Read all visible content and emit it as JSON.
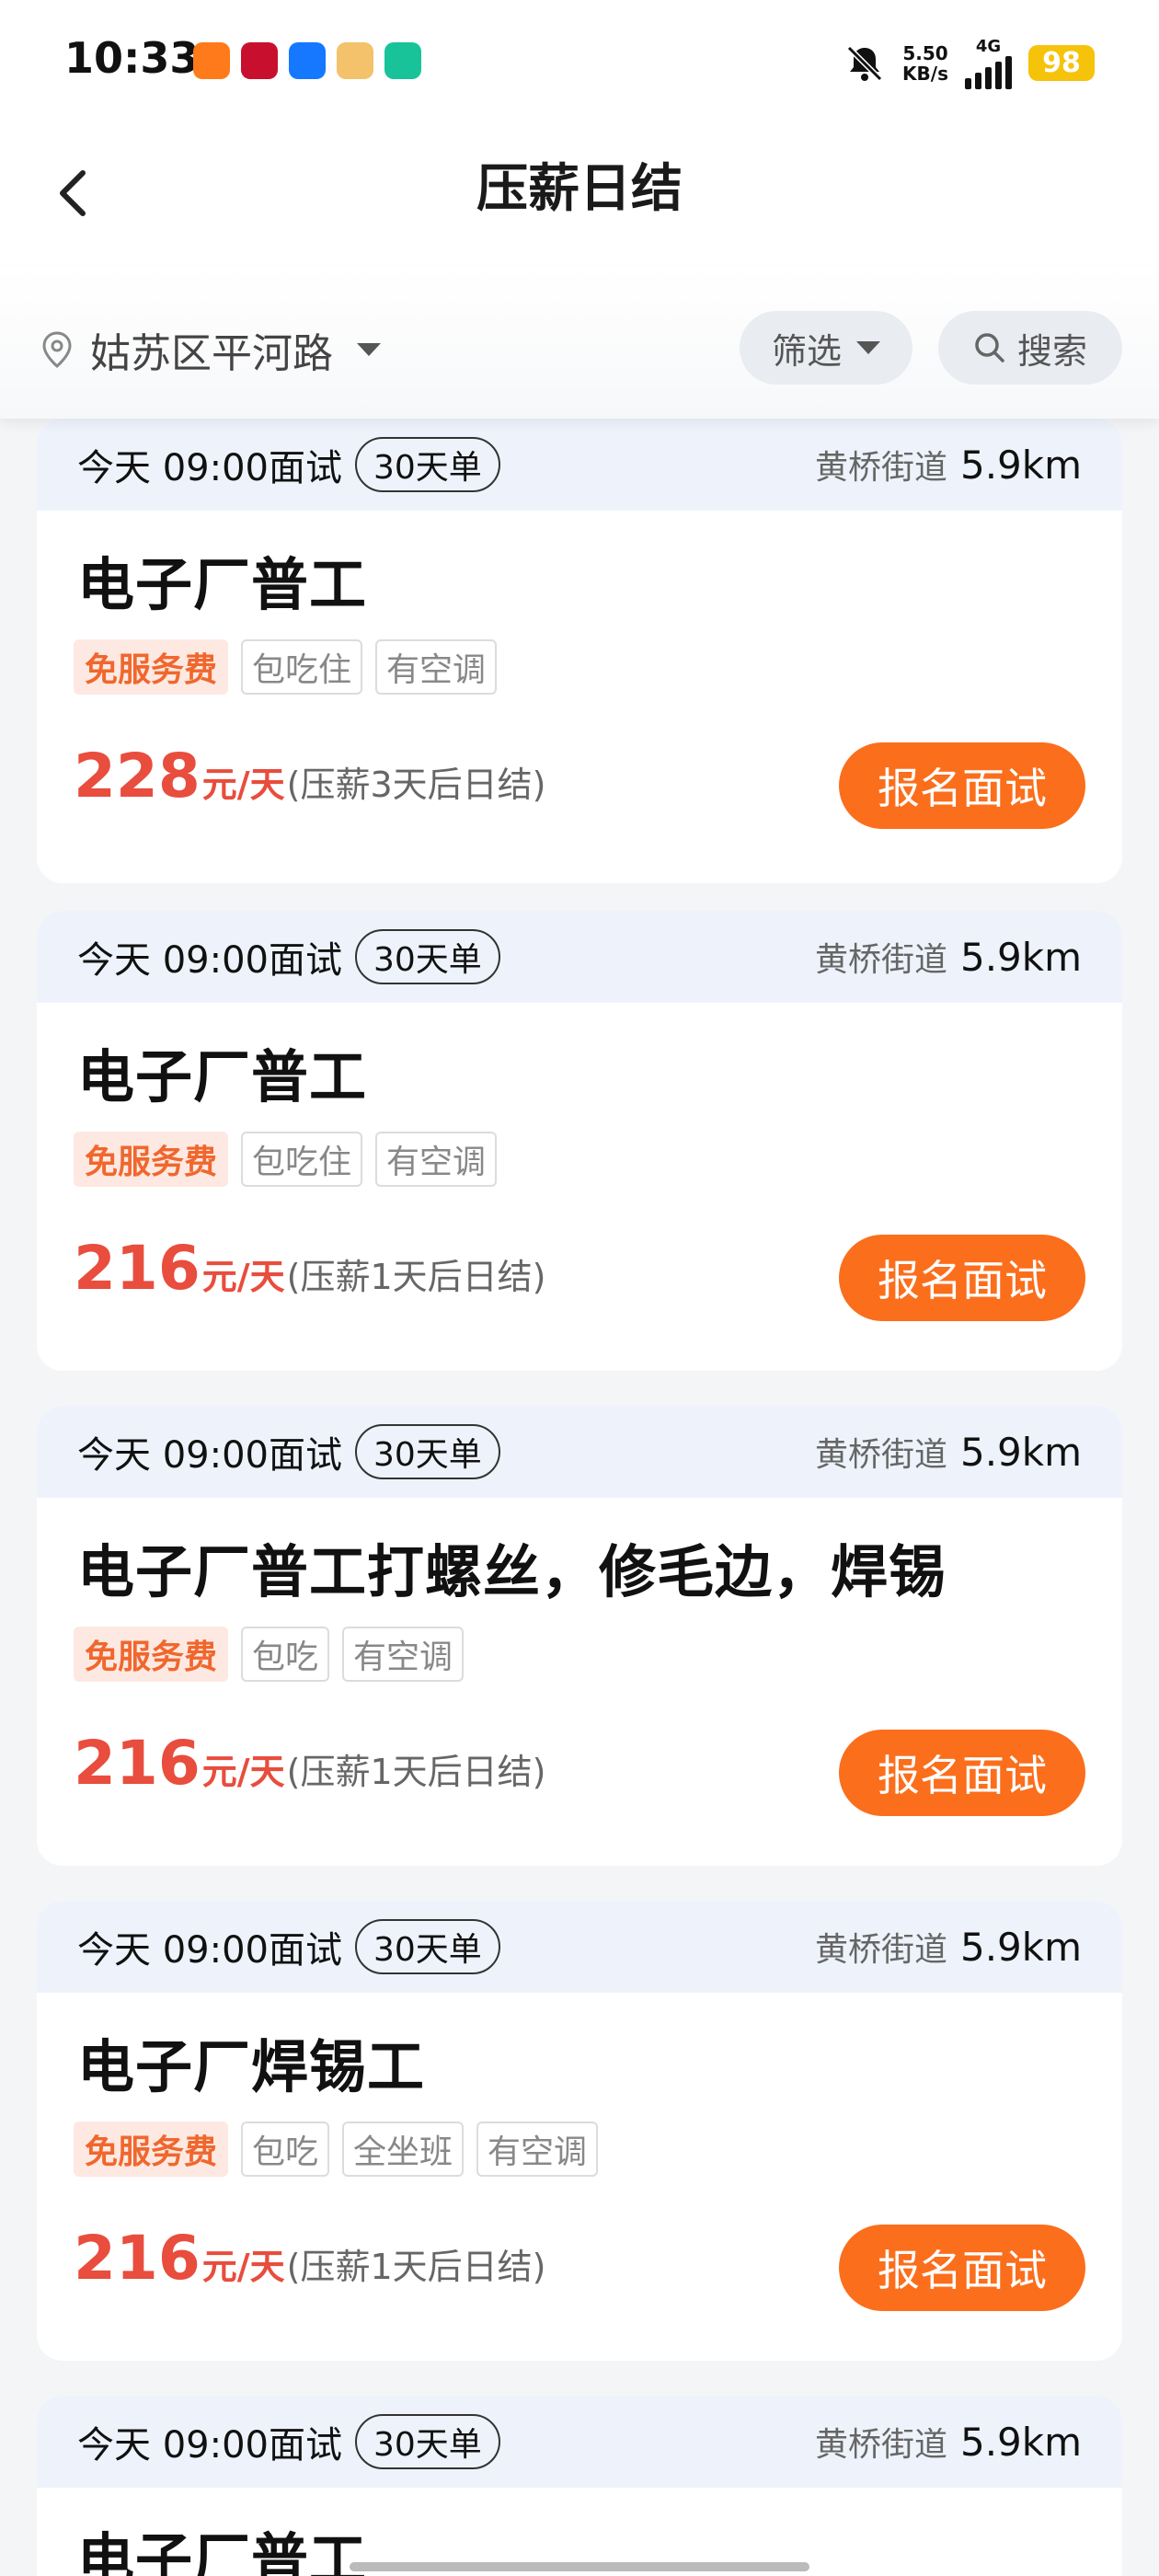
{
  "status_bar": {
    "time": "10:33",
    "speed_value": "5.50",
    "speed_unit": "KB/s",
    "network": "4G",
    "battery": "98",
    "app_icons": [
      "taobao-flash-icon",
      "bank-icon",
      "alipay-icon",
      "moneybag-icon",
      "shield-app-icon"
    ]
  },
  "header": {
    "title": "压薪日结"
  },
  "filter_bar": {
    "location": "姑苏区平河路",
    "filter_label": "筛选",
    "search_label": "搜索"
  },
  "colors": {
    "accent_orange": "#fb6e1c",
    "salary_red": "#e84d3d",
    "fee_tag_bg": "#fde9e1",
    "card_head_bg": "#eef3fb"
  },
  "jobs": [
    {
      "interview": "今天 09:00面试",
      "duration": "30天单",
      "street": "黄桥街道",
      "distance": "5.9km",
      "title": "电子厂普工",
      "tags": [
        "免服务费",
        "包吃住",
        "有空调"
      ],
      "amount": "228",
      "unit": "元/天",
      "note": "(压薪3天后日结)",
      "apply_label": "报名面试"
    },
    {
      "interview": "今天 09:00面试",
      "duration": "30天单",
      "street": "黄桥街道",
      "distance": "5.9km",
      "title": "电子厂普工",
      "tags": [
        "免服务费",
        "包吃住",
        "有空调"
      ],
      "amount": "216",
      "unit": "元/天",
      "note": "(压薪1天后日结)",
      "apply_label": "报名面试"
    },
    {
      "interview": "今天 09:00面试",
      "duration": "30天单",
      "street": "黄桥街道",
      "distance": "5.9km",
      "title": "电子厂普工打螺丝，修毛边，焊锡",
      "tags": [
        "免服务费",
        "包吃",
        "有空调"
      ],
      "amount": "216",
      "unit": "元/天",
      "note": "(压薪1天后日结)",
      "apply_label": "报名面试"
    },
    {
      "interview": "今天 09:00面试",
      "duration": "30天单",
      "street": "黄桥街道",
      "distance": "5.9km",
      "title": "电子厂焊锡工",
      "tags": [
        "免服务费",
        "包吃",
        "全坐班",
        "有空调"
      ],
      "amount": "216",
      "unit": "元/天",
      "note": "(压薪1天后日结)",
      "apply_label": "报名面试"
    },
    {
      "interview": "今天 09:00面试",
      "duration": "30天单",
      "street": "黄桥街道",
      "distance": "5.9km",
      "title": "电子厂普工"
    }
  ]
}
